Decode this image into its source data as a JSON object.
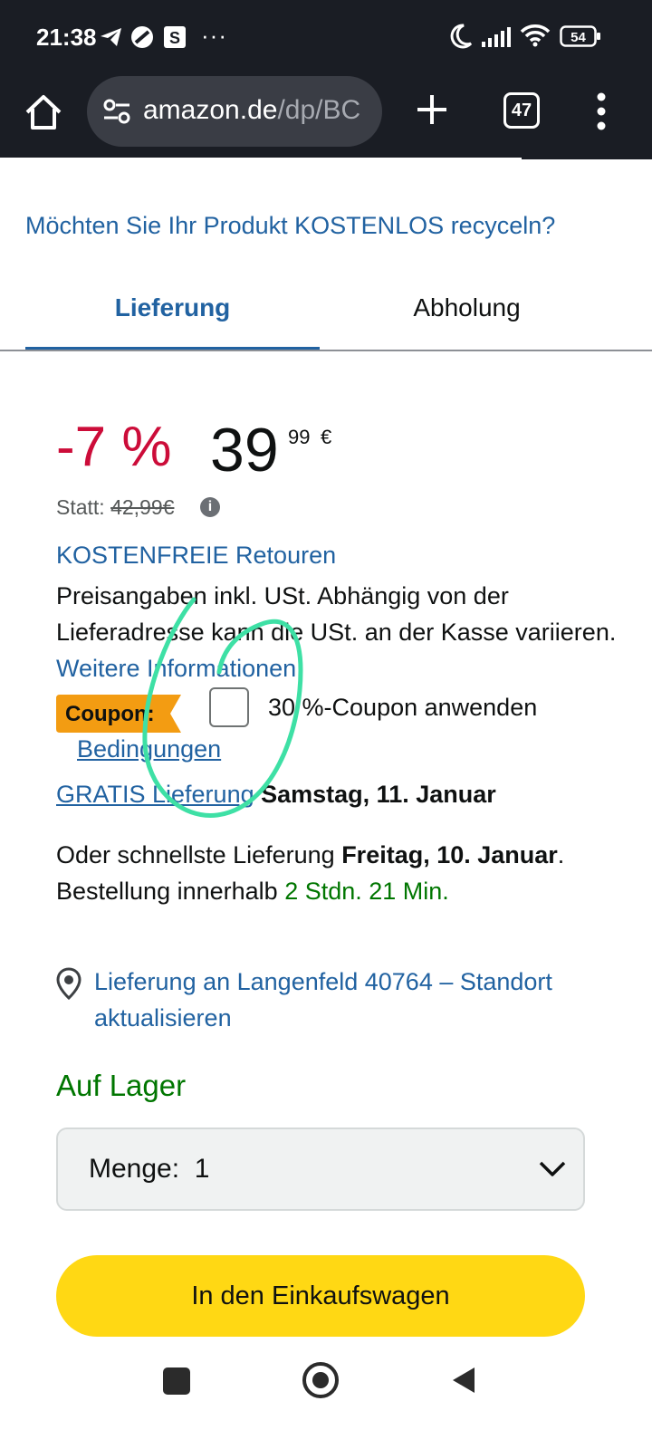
{
  "status_bar": {
    "time": "21:38",
    "ellipsis": "···",
    "battery": "54",
    "icons": [
      "telegram-icon",
      "no-disturb-app-icon",
      "s-app-icon",
      "moon-icon",
      "signal-icon",
      "wifi-icon",
      "battery-icon"
    ]
  },
  "browser": {
    "url_domain": "amazon.de",
    "url_path": "/dp/BC",
    "tab_count": "47",
    "icons": [
      "home-icon",
      "site-settings-icon",
      "plus-icon",
      "tabs-icon",
      "kebab-menu-icon"
    ]
  },
  "recycle_link": "Möchten Sie Ihr Produkt KOSTENLOS recyceln?",
  "tabs": {
    "delivery": "Lieferung",
    "pickup": "Abholung",
    "active": "delivery"
  },
  "price": {
    "discount": "-7 %",
    "whole": "39",
    "fraction": "99",
    "currency": "€",
    "statt_label": "Statt:",
    "old_price": "42,99€",
    "info_glyph": "i"
  },
  "returns_link": "KOSTENFREIE Retouren",
  "tax_info": {
    "text": "Preisangaben inkl. USt. Abhängig von der Lieferadresse kann die USt. an der Kasse variieren. ",
    "link": "Weitere Informationen."
  },
  "coupon": {
    "badge": "Coupon:",
    "label": "30 %-Coupon anwenden",
    "conditions": "Bedingungen",
    "checked": false
  },
  "delivery": {
    "gratis_link": "GRATIS Lieferung",
    "gratis_date": "Samstag, 11. Januar",
    "fast_prefix": "Oder schnellste Lieferung ",
    "fast_date": "Freitag, 10. Januar",
    "fast_mid": ". Bestellung innerhalb ",
    "countdown": "2 Stdn. 21 Min."
  },
  "location": {
    "text": "Lieferung an Langenfeld 40764 – Standort aktualisieren",
    "icon": "location-pin-icon"
  },
  "stock": "Auf Lager",
  "quantity": {
    "label": "Menge:",
    "value": "1"
  },
  "cart_button": "In den Einkaufswagen",
  "colors": {
    "link": "#2162a1",
    "discount": "#cc0c39",
    "in_stock": "#007600",
    "cart_button": "#ffd814",
    "coupon_badge": "#f39c12",
    "annotation": "#3ee0a5",
    "topbar": "#1a1d24"
  }
}
